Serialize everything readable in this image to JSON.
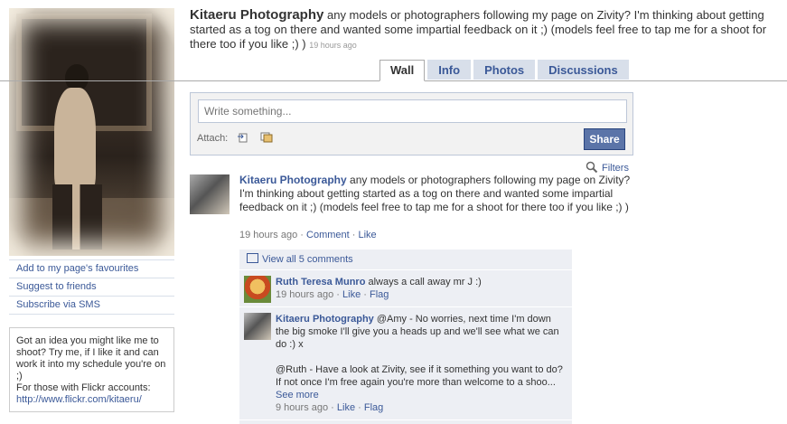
{
  "sidebar": {
    "links": [
      "Add to my page's favourites",
      "Suggest to friends",
      "Subscribe via SMS"
    ],
    "idea_text": "Got an idea you might like me to shoot? Try me, if I like it and can work it into my schedule you're on ;)",
    "flickr_text": "For those with Flickr accounts:",
    "flickr_url": "http://www.flickr.com/kitaeru/"
  },
  "header": {
    "page_name": "Kitaeru Photography",
    "status": "any models or photographers following my page on Zivity? I'm thinking about getting started as a tog on there and wanted some impartial feedback on it ;) (models feel free to tap me for a shoot for there too if you like ;) )",
    "time": "19 hours ago"
  },
  "tabs": [
    "Wall",
    "Info",
    "Photos",
    "Discussions"
  ],
  "composer": {
    "placeholder": "Write something...",
    "attach_label": "Attach:",
    "share_label": "Share"
  },
  "filters_label": "Filters",
  "story": {
    "author": "Kitaeru Photography",
    "text": "any models or photographers following my page on Zivity? I'm thinking about getting started as a tog on there and wanted some impartial feedback on it ;) (models feel free to tap me for a shoot for there too if you like ;) )",
    "time": "19 hours ago",
    "sep": "·",
    "comment_link": "Comment",
    "like_link": "Like"
  },
  "comments": {
    "view_all": "View all 5 comments",
    "items": [
      {
        "author": "Ruth Teresa Munro",
        "text": "always a call away mr J :)",
        "time": "19 hours ago",
        "like": "Like",
        "flag": "Flag"
      },
      {
        "author": "Kitaeru Photography",
        "text": "@Amy - No worries, next time I'm down the big smoke I'll give you a heads up and we'll see what we can do :) x",
        "text2": "@Ruth - Have a look at Zivity, see if it something you want to do? If not once I'm free again you're more than welcome to a shoo...",
        "see_more": "See more",
        "time": "9 hours ago",
        "like": "Like",
        "flag": "Flag"
      }
    ]
  },
  "colors": {
    "link": "#3b5998",
    "tab_bg": "#d8dfea",
    "comment_bg": "#edeff4",
    "share_button": "#5b74a8"
  },
  "icons": [
    "magnifier-icon",
    "comment-bubble-icon",
    "attach-link-icon",
    "attach-photo-icon"
  ]
}
